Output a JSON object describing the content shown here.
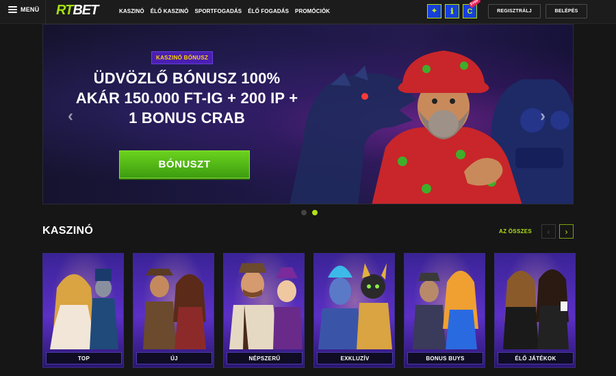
{
  "header": {
    "menu_label": "MENÜ",
    "logo": {
      "part1": "RT",
      "part2": "BET"
    },
    "nav": [
      "KASZINÓ",
      "ÉLŐ KASZINÓ",
      "SPORTFOGADÁS",
      "ÉLŐ FOGADÁS",
      "PROMÓCIÓK"
    ],
    "quick_icons": [
      {
        "name": "map-pin-icon",
        "glyph": "⌖"
      },
      {
        "name": "info-icon",
        "glyph": "ℹ"
      },
      {
        "name": "free-chips-icon",
        "glyph": "C",
        "tag": "Free"
      }
    ],
    "register_label": "REGISZTRÁLJ",
    "login_label": "BELÉPÉS"
  },
  "hero": {
    "badge": "KASZINÓ BÓNUSZ",
    "title": "ÜDVÖZLŐ BÓNUSZ 100% AKÁR 150.000 FT-IG + 200 IP + 1 BONUS CRAB",
    "cta_label": "BÓNUSZT",
    "prev_arrow": "‹",
    "next_arrow": "›",
    "slides_count": 2,
    "active_slide": 2
  },
  "casino": {
    "title": "KASZINÓ",
    "see_all": "AZ ÖSSZES",
    "prev": "‹",
    "next": "›",
    "categories": [
      "TOP",
      "ÚJ",
      "NÉPSZERŰ",
      "EXKLUZÍV",
      "BONUS BUYS",
      "ÉLŐ JÁTÉKOK"
    ]
  },
  "colors": {
    "accent": "#b3e01a",
    "brand_blue": "#1640d8",
    "cta_green": "#4fb816",
    "badge_purple": "#4a1fb0",
    "badge_text": "#ffd200"
  }
}
